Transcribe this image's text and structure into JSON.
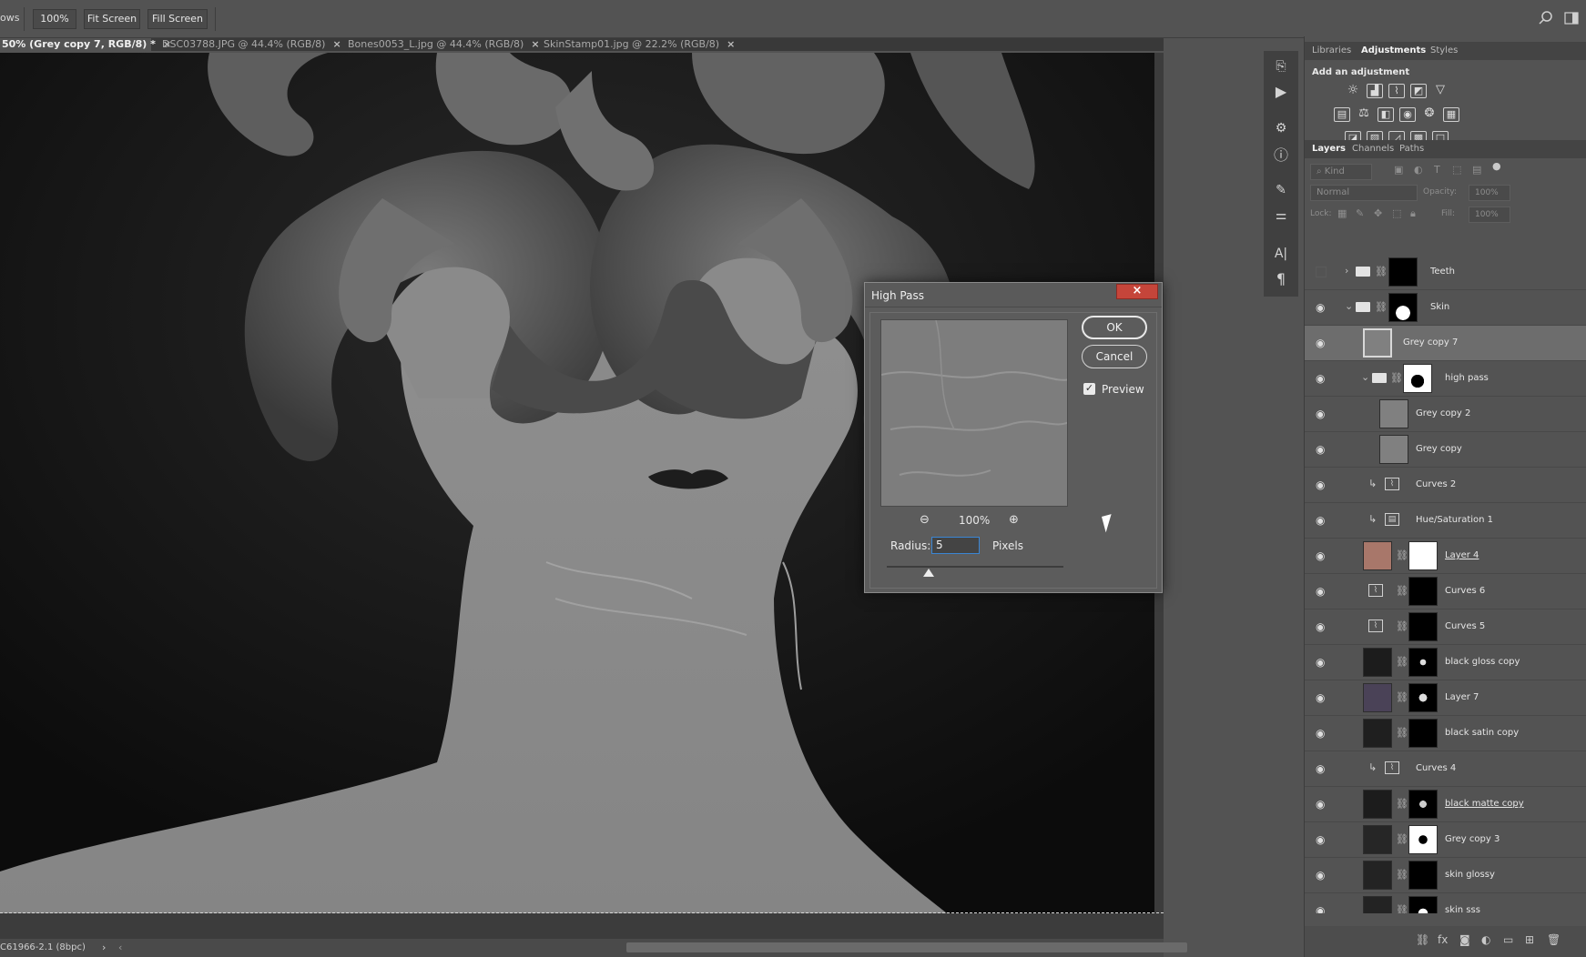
{
  "options_bar": {
    "left_label": "ows",
    "zoom_button": "100%",
    "fit_screen": "Fit Screen",
    "fill_screen": "Fill Screen"
  },
  "tabs": [
    {
      "label": "50% (Grey copy 7, RGB/8) *",
      "active": true
    },
    {
      "label": "DSC03788.JPG @ 44.4% (RGB/8)",
      "active": false
    },
    {
      "label": "Bones0053_L.jpg @ 44.4% (RGB/8)",
      "active": false
    },
    {
      "label": "SkinStamp01.jpg @ 22.2% (RGB/8)",
      "active": false
    }
  ],
  "tab_close_glyph": "×",
  "status_bar": {
    "text": "C61966-2.1 (8bpc)"
  },
  "panels": {
    "top_tabs": [
      "Libraries",
      "Adjustments",
      "Styles"
    ],
    "active_top_tab": "Adjustments",
    "adjustments_heading": "Add an adjustment",
    "layer_tabs": [
      "Layers",
      "Channels",
      "Paths"
    ],
    "active_layer_tab": "Layers",
    "kind_placeholder": "Kind",
    "blend_mode": "Normal",
    "opacity_label": "Opacity:",
    "opacity_value": "100%",
    "lock_label": "Lock:",
    "fill_label": "Fill:",
    "fill_value": "100%"
  },
  "layers": [
    {
      "name": "Teeth",
      "type": "group",
      "visible": false,
      "selected": false
    },
    {
      "name": "Skin",
      "type": "group",
      "visible": true,
      "selected": false
    },
    {
      "name": "Grey copy 7",
      "type": "pixel",
      "visible": true,
      "selected": true
    },
    {
      "name": "high pass",
      "type": "group",
      "visible": true,
      "selected": false
    },
    {
      "name": "Grey copy 2",
      "type": "pixel",
      "visible": true,
      "selected": false
    },
    {
      "name": "Grey copy",
      "type": "pixel",
      "visible": true,
      "selected": false
    },
    {
      "name": "Curves 2",
      "type": "adjustment",
      "visible": true,
      "selected": false
    },
    {
      "name": "Hue/Saturation 1",
      "type": "adjustment",
      "visible": true,
      "selected": false
    },
    {
      "name": "Layer 4",
      "type": "masked",
      "visible": true,
      "selected": false
    },
    {
      "name": "Curves 6",
      "type": "masked-adjustment",
      "visible": true,
      "selected": false
    },
    {
      "name": "Curves 5",
      "type": "masked-adjustment",
      "visible": true,
      "selected": false
    },
    {
      "name": "black gloss copy",
      "type": "masked",
      "visible": true,
      "selected": false
    },
    {
      "name": "Layer 7",
      "type": "masked",
      "visible": true,
      "selected": false
    },
    {
      "name": "black satin copy",
      "type": "masked",
      "visible": true,
      "selected": false
    },
    {
      "name": "Curves 4",
      "type": "adjustment",
      "visible": true,
      "selected": false
    },
    {
      "name": "black matte copy",
      "type": "masked",
      "visible": true,
      "selected": false
    },
    {
      "name": "Grey copy 3",
      "type": "masked",
      "visible": true,
      "selected": false
    },
    {
      "name": "skin glossy",
      "type": "masked",
      "visible": true,
      "selected": false
    },
    {
      "name": "skin sss",
      "type": "masked",
      "visible": true,
      "selected": false
    }
  ],
  "dialog": {
    "title": "High Pass",
    "close_glyph": "×",
    "ok_label": "OK",
    "cancel_label": "Cancel",
    "preview_label": "Preview",
    "preview_checked": true,
    "zoom_value": "100%",
    "radius_label": "Radius:",
    "radius_value": "5",
    "radius_unit": "Pixels"
  },
  "colors": {
    "app_bg": "#535353",
    "panel_dark": "#444444",
    "document_bg": "#121212",
    "skin_grey": "#8c8c8c",
    "close_red": "#c5453a",
    "selected_layer": "#6d6d6d",
    "input_focus": "#3b86d4"
  }
}
